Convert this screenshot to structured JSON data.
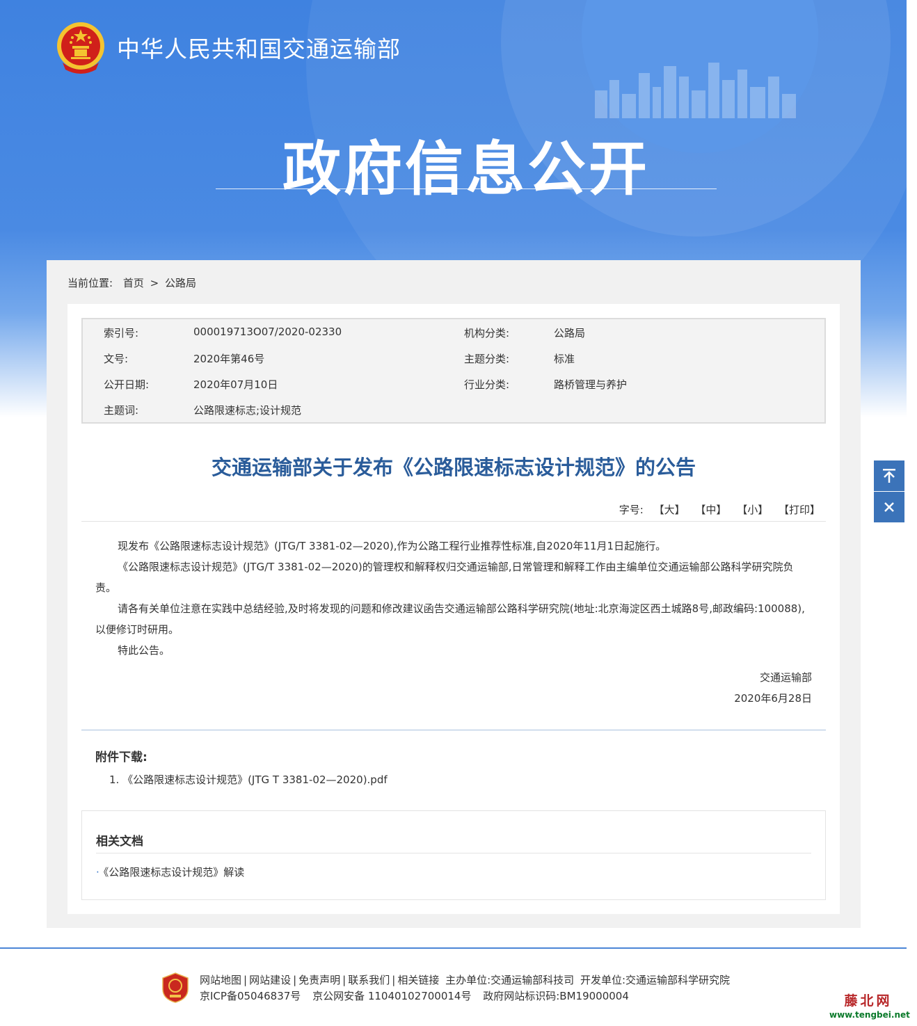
{
  "header": {
    "ministry_name": "中华人民共和国交通运输部",
    "banner_title": "政府信息公开"
  },
  "breadcrumb": {
    "label": "当前位置:",
    "home": "首页",
    "separator": ">",
    "current": "公路局"
  },
  "meta": {
    "index_no_label": "索引号:",
    "index_no": "000019713O07/2020-02330",
    "org_label": "机构分类:",
    "org": "公路局",
    "doc_no_label": "文号:",
    "doc_no": "2020年第46号",
    "topic_label": "主题分类:",
    "topic": "标准",
    "pub_date_label": "公开日期:",
    "pub_date": "2020年07月10日",
    "industry_label": "行业分类:",
    "industry": "路桥管理与养护",
    "keywords_label": "主题词:",
    "keywords": "公路限速标志;设计规范"
  },
  "article": {
    "title": "交通运输部关于发布《公路限速标志设计规范》的公告",
    "font_size_label": "字号:",
    "font_large": "【大】",
    "font_medium": "【中】",
    "font_small": "【小】",
    "print": "【打印】",
    "paragraphs": [
      "现发布《公路限速标志设计规范》(JTG/T 3381-02—2020),作为公路工程行业推荐性标准,自2020年11月1日起施行。",
      "《公路限速标志设计规范》(JTG/T 3381-02—2020)的管理权和解释权归交通运输部,日常管理和解释工作由主编单位交通运输部公路科学研究院负责。",
      "请各有关单位注意在实践中总结经验,及时将发现的问题和修改建议函告交通运输部公路科学研究院(地址:北京海淀区西土城路8号,邮政编码:100088),以便修订时研用。",
      "特此公告。"
    ],
    "signer": "交通运输部",
    "sign_date": "2020年6月28日"
  },
  "attachments": {
    "title": "附件下载:",
    "items": [
      "1. 《公路限速标志设计规范》(JTG T 3381-02—2020).pdf"
    ]
  },
  "related": {
    "title": "相关文档",
    "items": [
      "《公路限速标志设计规范》解读"
    ]
  },
  "side_tools": {
    "top_icon": "back-to-top-icon",
    "close_icon": "close-icon"
  },
  "footer": {
    "links": [
      "网站地图",
      "网站建设",
      "免责声明",
      "联系我们",
      "相关链接"
    ],
    "link_separator": "|",
    "sponsor": "主办单位:交通运输部科技司",
    "developer": "开发单位:交通运输部科学研究院",
    "icp": "京ICP备05046837号",
    "police": "京公网安备 11040102700014号",
    "site_id": "政府网站标识码:BM19000004"
  },
  "watermark": {
    "name": "藤北网",
    "url": "www.tengbei.net"
  },
  "colors": {
    "banner_blue": "#3f82e0",
    "title_blue": "#2a5c9a",
    "side_button": "#3b73b9",
    "emblem_red": "#d0201a",
    "emblem_gold": "#f4c430"
  }
}
